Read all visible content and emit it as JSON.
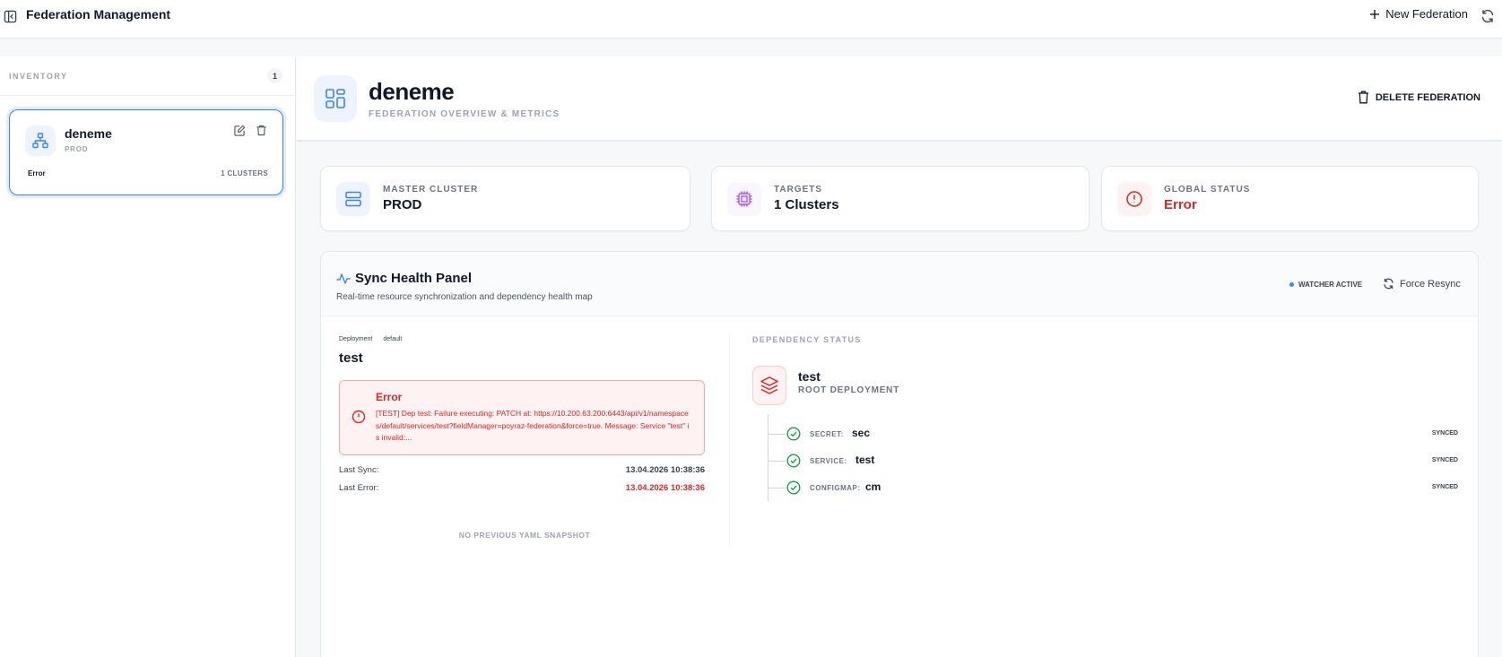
{
  "header": {
    "title": "Federation Management",
    "new_federation_label": "New Federation"
  },
  "sidebar": {
    "inventory_title": "INVENTORY",
    "inventory_count": "1",
    "federations": [
      {
        "name": "deneme",
        "master": "PROD",
        "status": "Error",
        "clusters": "1 CLUSTERS"
      }
    ]
  },
  "main": {
    "title": "deneme",
    "subtitle": "FEDERATION OVERVIEW & METRICS",
    "delete_label": "DELETE FEDERATION",
    "stats": [
      {
        "label": "MASTER CLUSTER",
        "value": "PROD",
        "color": "#111827",
        "icon": "server-icon"
      },
      {
        "label": "TARGETS",
        "value": "1 Clusters",
        "color": "#111827",
        "icon": "chip-icon"
      },
      {
        "label": "GLOBAL STATUS",
        "value": "Error",
        "color": "#dc2626",
        "icon": "alert-circle-icon"
      }
    ],
    "sync_panel": {
      "title": "Sync Health Panel",
      "subtitle": "Real-time resource synchronization and dependency health map",
      "watcher_label": "WATCHER ACTIVE",
      "force_resync_label": "Force Resync",
      "resource": {
        "kind": "Deployment",
        "namespace": "default",
        "name": "test",
        "error_title": "Error",
        "error_message": "[TEST] Dep test: Failure executing: PATCH at: https://10.200.63.200:6443/api/v1/namespaces/default/services/test?fieldManager=poyraz-federation&force=true. Message: Service \"test\" is invalid:...",
        "last_sync_label": "Last Sync:",
        "last_sync_value": "13.04.2026 10:38:36",
        "last_error_label": "Last Error:",
        "last_error_value": "13.04.2026 10:38:36",
        "no_snapshot_label": "NO PREVIOUS YAML SNAPSHOT"
      },
      "dependency": {
        "title": "DEPENDENCY STATUS",
        "root_name": "test",
        "root_kind": "ROOT DEPLOYMENT",
        "items": [
          {
            "kind": "SECRET:",
            "name": "sec",
            "state": "SYNCED"
          },
          {
            "kind": "SERVICE:",
            "name": "test",
            "state": "SYNCED"
          },
          {
            "kind": "CONFIGMAP:",
            "name": "cm",
            "state": "SYNCED"
          }
        ]
      }
    }
  },
  "colors": {
    "accent": "#3b82f6",
    "error": "#dc2626",
    "success": "#16a34a",
    "purple": "#a855f7"
  }
}
